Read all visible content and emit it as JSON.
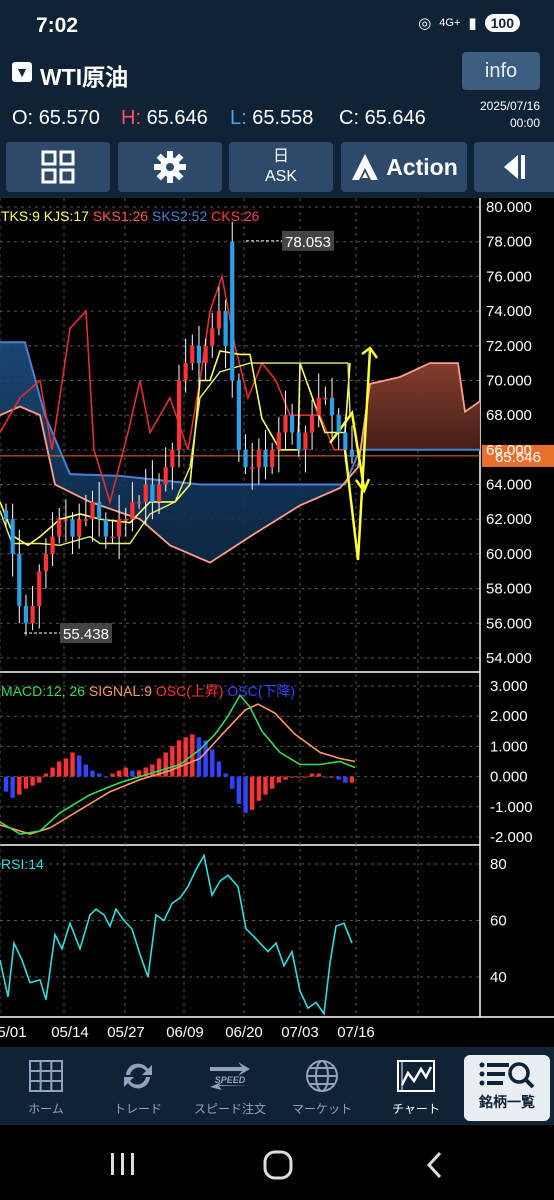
{
  "status_bar": {
    "time": "7:02",
    "network": "4G+",
    "battery": "100"
  },
  "header": {
    "symbol": "WTI原油",
    "info_label": "info",
    "ohlc": [
      {
        "key": "O:",
        "value": "65.570"
      },
      {
        "key": "H:",
        "value": "65.646"
      },
      {
        "key": "L:",
        "value": "65.558"
      },
      {
        "key": "C:",
        "value": "65.646"
      }
    ],
    "date": "2025/07/16",
    "time": "00:00"
  },
  "toolbar": {
    "grid_icon": "grid-icon",
    "settings_icon": "gear-icon",
    "ask_top": "日",
    "ask_label": "ASK",
    "action_label": "Action",
    "collapse_icon": "collapse-left-icon"
  },
  "chart_data": [
    {
      "type": "candlestick",
      "legend": [
        {
          "label": "TKS:9",
          "color": "#ffff66"
        },
        {
          "label": "KJS:17",
          "color": "#ffff66"
        },
        {
          "label": "SKS1:26",
          "color": "#ff5555"
        },
        {
          "label": "SKS2:52",
          "color": "#4a7fd4"
        },
        {
          "label": "CKS:26",
          "color": "#ff4040"
        }
      ],
      "y_ticks": [
        "80.000",
        "78.000",
        "76.000",
        "74.000",
        "72.000",
        "70.000",
        "68.000",
        "66.000",
        "64.000",
        "62.000",
        "60.000",
        "58.000",
        "56.000",
        "54.000"
      ],
      "ylim": [
        53,
        80.2
      ],
      "high_marker": "78.053",
      "low_marker": "55.438",
      "current_price": "65.646",
      "approx_closes": [
        62,
        60,
        57,
        56,
        57,
        59,
        60,
        61,
        62,
        62,
        61,
        62,
        62,
        63,
        62,
        61,
        61,
        62,
        62,
        63,
        63,
        64,
        63,
        64,
        65,
        66,
        70,
        71,
        72,
        71,
        72,
        73,
        74,
        72,
        70,
        66,
        65,
        65,
        66,
        65,
        66,
        67,
        68,
        67,
        66,
        67,
        68,
        69,
        69,
        68,
        67,
        66,
        65.6
      ]
    },
    {
      "type": "macd",
      "legend": [
        {
          "label": "MACD:12, 26",
          "color": "#33dd55"
        },
        {
          "label": "SIGNAL:9",
          "color": "#ff9966"
        },
        {
          "label": "OSC(上昇)",
          "color": "#ff3333"
        },
        {
          "label": "OSC(下降)",
          "color": "#3344ff"
        }
      ],
      "y_ticks": [
        "3.000",
        "2.000",
        "1.000",
        "0.000",
        "-1.000",
        "-2.000"
      ],
      "ylim": [
        -2.1,
        3.3
      ]
    },
    {
      "type": "rsi",
      "legend": [
        {
          "label": "RSI:14",
          "color": "#33dddd"
        }
      ],
      "y_ticks": [
        "80",
        "60",
        "40"
      ],
      "ylim": [
        25,
        86
      ]
    }
  ],
  "x_ticks": [
    "5/01",
    "05/14",
    "05/27",
    "06/09",
    "06/20",
    "07/03",
    "07/16"
  ],
  "bottom_nav": [
    {
      "label": "ホーム",
      "icon": "home-grid-icon"
    },
    {
      "label": "トレード",
      "icon": "trade-arrows-icon"
    },
    {
      "label": "スピード注文",
      "icon": "speed-icon"
    },
    {
      "label": "マーケット",
      "icon": "globe-icon"
    },
    {
      "label": "チャート",
      "icon": "chart-icon"
    },
    {
      "label": "銘柄一覧",
      "icon": "list-search-icon"
    }
  ],
  "colors": {
    "bg": "#000000",
    "panel": "#0f2236",
    "button": "#2d4a6a",
    "up": "#ff3333",
    "down": "#2aa0e8",
    "price_tag": "#e8702a"
  }
}
